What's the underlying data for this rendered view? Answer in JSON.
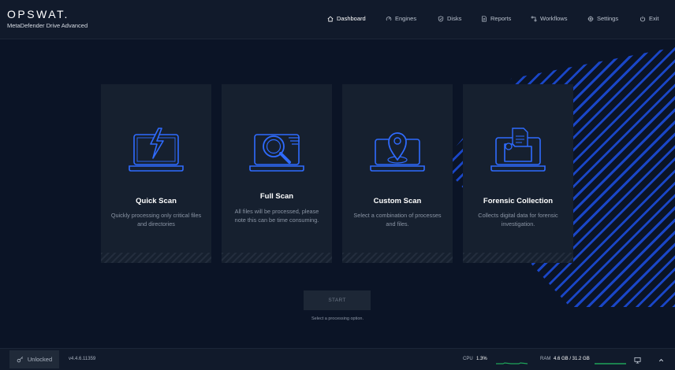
{
  "brand": {
    "logo": "OPSWAT.",
    "product": "MetaDefender Drive Advanced"
  },
  "nav": [
    {
      "label": "Dashboard",
      "icon": "home-icon",
      "active": true
    },
    {
      "label": "Engines",
      "icon": "engines-icon",
      "active": false
    },
    {
      "label": "Disks",
      "icon": "shield-check-icon",
      "active": false
    },
    {
      "label": "Reports",
      "icon": "report-icon",
      "active": false
    },
    {
      "label": "Workflows",
      "icon": "workflows-icon",
      "active": false
    },
    {
      "label": "Settings",
      "icon": "gear-icon",
      "active": false
    },
    {
      "label": "Exit",
      "icon": "power-icon",
      "active": false
    }
  ],
  "cards": [
    {
      "title": "Quick Scan",
      "description": "Quickly processing only critical files and directories",
      "icon": "laptop-lightning-icon"
    },
    {
      "title": "Full Scan",
      "description": "All files will be processed, please note this can be time consuming.",
      "icon": "laptop-magnifier-icon"
    },
    {
      "title": "Custom Scan",
      "description": "Select a combination of processes and files.",
      "icon": "laptop-location-pin-icon"
    },
    {
      "title": "Forensic Collection",
      "description": "Collects digital data for forensic investigation.",
      "icon": "laptop-document-folder-icon"
    }
  ],
  "start": {
    "label": "START",
    "hint": "Select a processing option."
  },
  "status": {
    "lock_label": "Unlocked",
    "version": "v4.4.6.11359",
    "cpu_label": "CPU",
    "cpu_value": "1.3%",
    "ram_label": "RAM",
    "ram_value": "4.6 GB / 31.2 GB"
  },
  "colors": {
    "accent_blue": "#1b4cd9",
    "icon_blue": "#2f6bff",
    "spark_green": "#1fa35a",
    "background": "#0b1426",
    "card": "#16202f"
  }
}
